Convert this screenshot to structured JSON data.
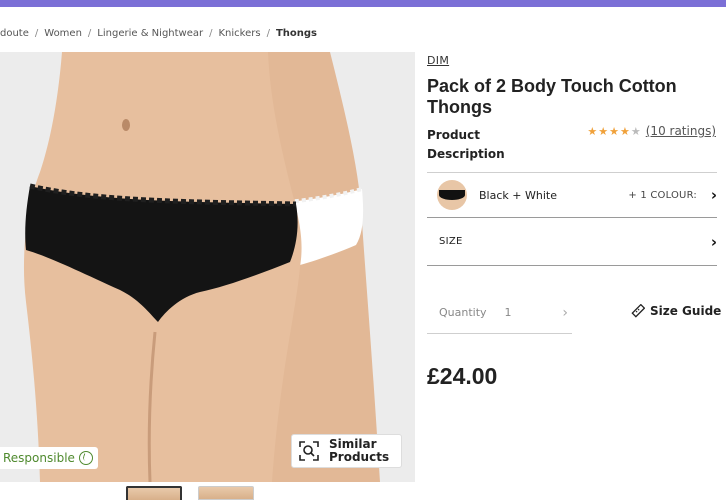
{
  "breadcrumb": {
    "items": [
      "doute",
      "Women",
      "Lingerie & Nightwear",
      "Knickers",
      "Thongs"
    ],
    "separator": "/"
  },
  "gallery": {
    "badge_label": "Responsible",
    "similar_label": "Similar Products",
    "thumbnails": 2
  },
  "product": {
    "brand": "DIM",
    "title": "Pack of 2 Body Touch Cotton Thongs",
    "description_link": "Product Description",
    "rating": {
      "stars": 4,
      "max": 5,
      "count_label": "(10 ratings)"
    },
    "colour": {
      "name": "Black + White",
      "more": "+ 1 COLOUR:"
    },
    "size_label": "SIZE",
    "quantity": {
      "label": "Quantity",
      "value": "1"
    },
    "size_guide_label": "Size Guide",
    "price": "£24.00"
  },
  "colors": {
    "accent_bar": "#7b6fd6",
    "star": "#f0a13a",
    "responsible_green": "#4f8a2e"
  }
}
